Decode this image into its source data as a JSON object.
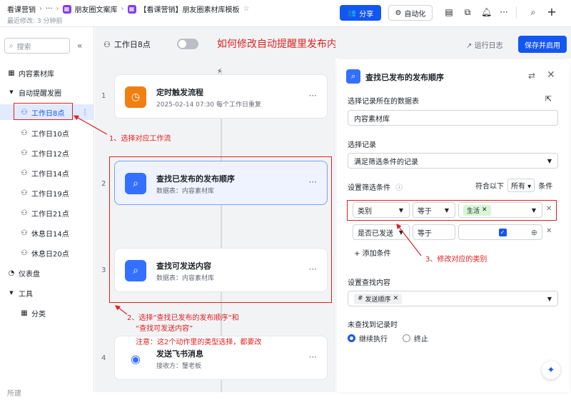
{
  "header": {
    "crumb1": "看课营销",
    "crumb2": "···",
    "crumb3": "朋友圈文案库",
    "crumb4": "【看课营销】朋友圈素材库模板",
    "last_edit": "最近修改: 3 分钟前",
    "share_label": "分享",
    "automation_label": "自动化"
  },
  "sidebar": {
    "search_placeholder": "搜索",
    "items": [
      {
        "label": "内容素材库"
      },
      {
        "label": "自动提醒发圈"
      },
      {
        "label": "工作日8点"
      },
      {
        "label": "工作日10点"
      },
      {
        "label": "工作日12点"
      },
      {
        "label": "工作日14点"
      },
      {
        "label": "工作日19点"
      },
      {
        "label": "工作日21点"
      },
      {
        "label": "休息日14点"
      },
      {
        "label": "休息日20点"
      },
      {
        "label": "仪表盘"
      },
      {
        "label": "工具"
      },
      {
        "label": "分类"
      }
    ],
    "bottom_label": "所建"
  },
  "canvas": {
    "workflow_title": "工作日8点",
    "question": "如何修改自动提醒里发布内容的类别?",
    "steps": [
      {
        "num": "1",
        "title": "定时触发流程",
        "sub": "2025-02-14 07:30 每个工作日重复"
      },
      {
        "num": "2",
        "title": "查找已发布的发布顺序",
        "sub": "数据表：内容素材库"
      },
      {
        "num": "3",
        "title": "查找可发送内容",
        "sub": "数据表：内容素材库"
      },
      {
        "num": "4",
        "title": "发送飞书消息",
        "sub": "接收方：蟹老板"
      }
    ],
    "anno1": "1、选择对应工作流",
    "anno2a": "2、选择“查找已发布的发布顺序”和",
    "anno2b": "“查找可发送内容”",
    "anno2c": "注意：这2个动作里的类型选择，都要改"
  },
  "panel": {
    "run_log": "运行日志",
    "save_label": "保存并启用",
    "title": "查找已发布的发布顺序",
    "table_label": "选择记录所在的数据表",
    "table_value": "内容素材库",
    "record_label": "选择记录",
    "record_value": "满足筛选条件的记录",
    "filter_label": "设置筛选条件",
    "match_prefix": "符合以下",
    "match_value": "所有",
    "match_suffix": "条件",
    "cond1_field": "类别",
    "cond1_op": "等于",
    "cond1_value": "生活",
    "cond2_field": "是否已发送",
    "cond2_op": "等于",
    "add_condition": "添加条件",
    "anno3": "3、修改对应的类别",
    "content_label": "设置查找内容",
    "content_value": "发送顺序",
    "notfound_label": "未查找到记录时",
    "opt_continue": "继续执行",
    "opt_stop": "终止"
  },
  "colors": {
    "brand": "#1456f0",
    "annotation": "#e02020",
    "trigger": "#f07f12"
  }
}
